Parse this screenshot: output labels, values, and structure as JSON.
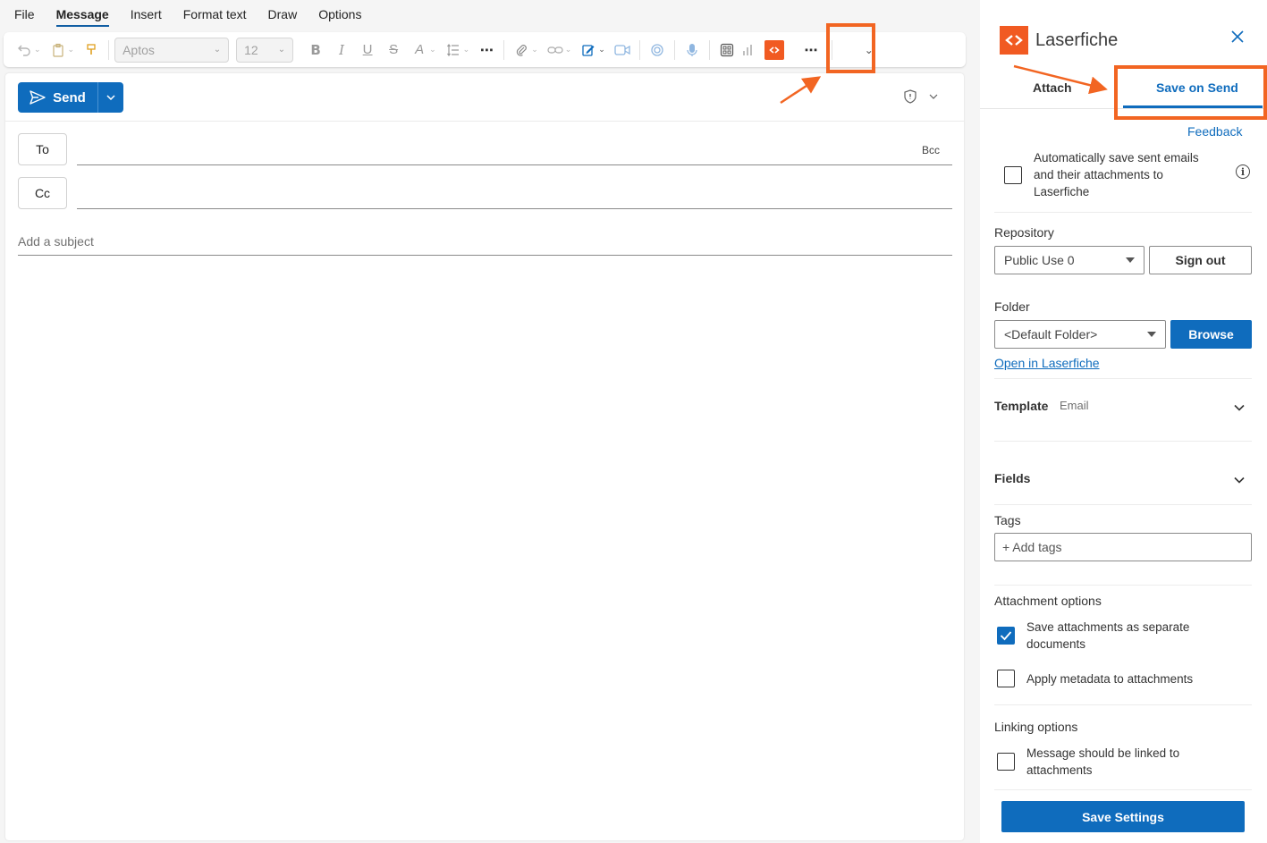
{
  "menu": {
    "items": [
      "File",
      "Message",
      "Insert",
      "Format text",
      "Draw",
      "Options"
    ],
    "active": "Message"
  },
  "ribbon": {
    "font_name": "Aptos",
    "font_size": "12",
    "icons": [
      "undo-icon",
      "paste-icon",
      "format-painter-icon",
      "bold-icon",
      "italic-icon",
      "underline-icon",
      "strikethrough-icon",
      "highlight-icon",
      "line-spacing-icon",
      "more-icon",
      "attach-icon",
      "link-icon",
      "signature-icon",
      "meeting-icon",
      "loop-icon",
      "dictate-icon",
      "apps-icon",
      "insights-icon",
      "laserfiche-icon",
      "more-icon",
      "expand-icon"
    ]
  },
  "compose": {
    "send_label": "Send",
    "to_label": "To",
    "cc_label": "Cc",
    "bcc_label": "Bcc",
    "subject_placeholder": "Add a subject"
  },
  "pane": {
    "title": "Laserfiche",
    "tabs": [
      "Attach",
      "Save on Send"
    ],
    "active_tab": "Save on Send",
    "feedback": "Feedback",
    "auto_save_line1": "Automatically save sent emails",
    "auto_save_line2": "and their attachments to",
    "auto_save_line3": "Laserfiche",
    "auto_save_checked": false,
    "repository_label": "Repository",
    "repository_value": "Public Use 0",
    "sign_out": "Sign out",
    "folder_label": "Folder",
    "folder_value": "<Default Folder>",
    "browse": "Browse",
    "open_in": "Open in Laserfiche",
    "template_label": "Template",
    "template_value": "Email",
    "fields_label": "Fields",
    "tags_label": "Tags",
    "tags_placeholder": "+ Add tags",
    "attachment_options_label": "Attachment options",
    "save_separate_line1": "Save attachments as separate",
    "save_separate_line2": "documents",
    "save_separate_checked": true,
    "apply_metadata": "Apply metadata to attachments",
    "apply_metadata_checked": false,
    "linking_options_label": "Linking options",
    "linked_line1": "Message should be linked to",
    "linked_line2": "attachments",
    "linked_checked": false,
    "save_settings": "Save Settings"
  },
  "colors": {
    "accent": "#0f6cbd",
    "laserfiche_orange": "#f15a22",
    "highlight": "#f26522"
  }
}
